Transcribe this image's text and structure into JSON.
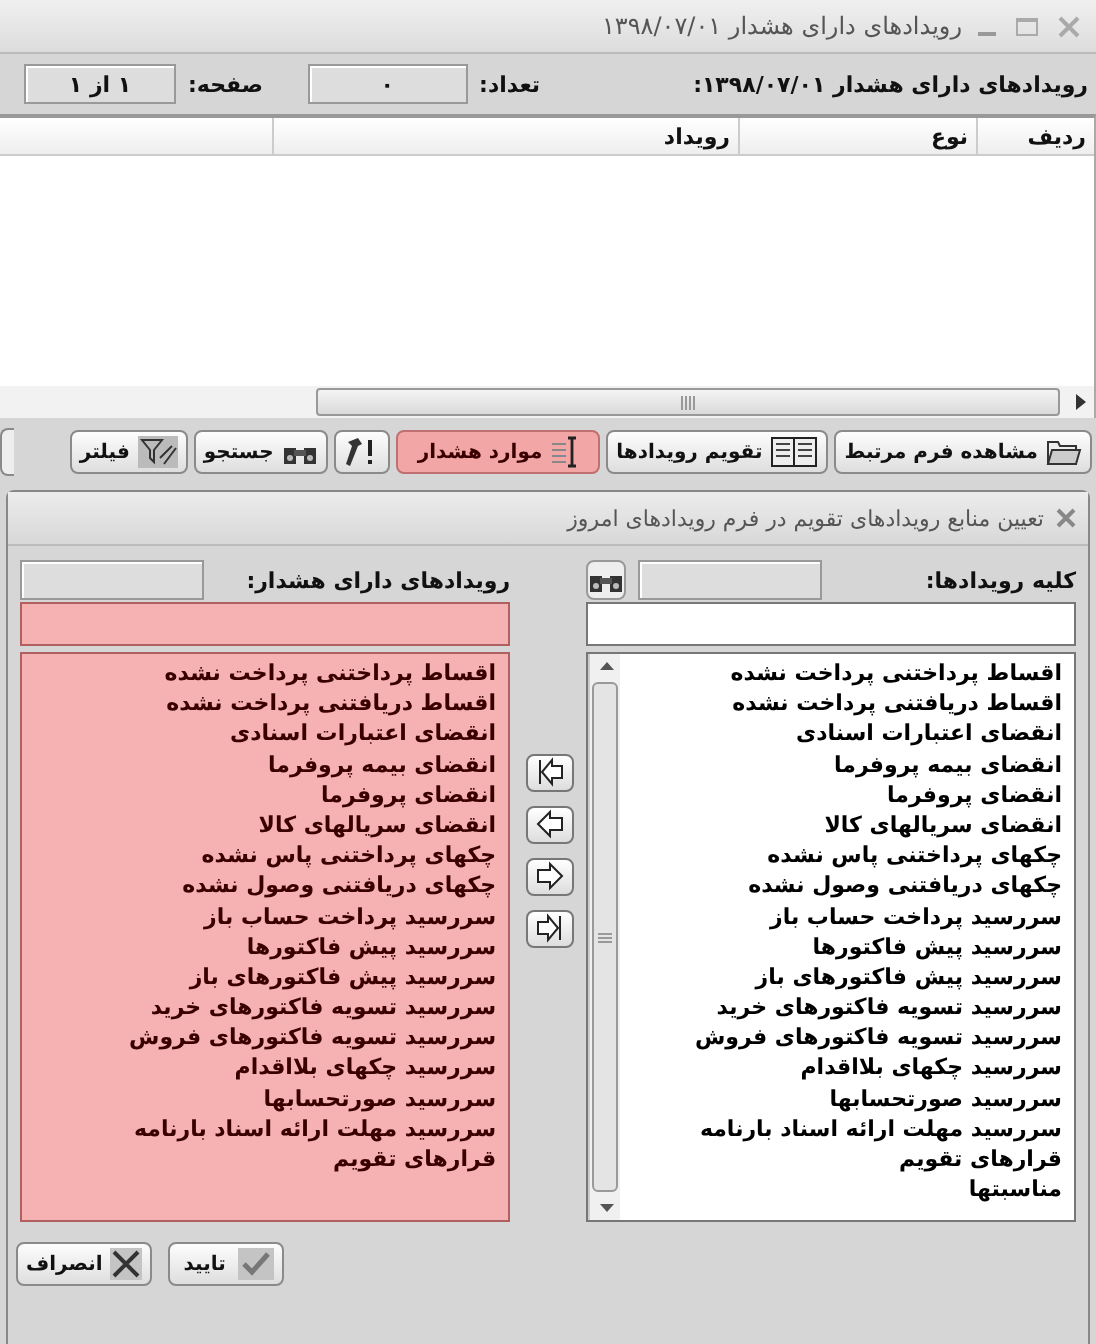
{
  "window": {
    "title": "رویدادهای دارای هشدار ۱۳۹۸/۰۷/۰۱"
  },
  "summary": {
    "label": "رویدادهای دارای هشدار ۱۳۹۸/۰۷/۰۱:",
    "count_label": "تعداد:",
    "count": "۰",
    "page_label": "صفحه:",
    "page": "۱ از ۱"
  },
  "table": {
    "columns": [
      "ردیف",
      "نوع",
      "رویداد"
    ]
  },
  "toolbar": [
    {
      "label": "مشاهده فرم مرتبط",
      "kind": "folder",
      "highlighted": false
    },
    {
      "label": "تقویم رویدادها",
      "kind": "book",
      "highlighted": false
    },
    {
      "label": "موارد هشدار",
      "kind": "list",
      "highlighted": true
    },
    {
      "kind": "tools",
      "highlighted": false
    },
    {
      "label": "جستجو",
      "kind": "binoculars",
      "highlighted": false
    },
    {
      "label": "فیلتر",
      "kind": "funnel",
      "highlighted": false
    }
  ],
  "dialog": {
    "title": "تعیین منابع رویدادهای تقویم در فرم رویدادهای امروز",
    "source": {
      "label": "کلیه رویدادها:",
      "highlighted": false,
      "items": [
        "اقساط پرداختنی پرداخت نشده",
        "اقساط دریافتنی پرداخت نشده",
        "انقضای اعتبارات اسنادی",
        "انقضای بیمه پروفرما",
        "انقضای پروفرما",
        "انقضای سریالهای کالا",
        "چکهای پرداختنی پاس نشده",
        "چکهای دریافتنی وصول نشده",
        "سررسید پرداخت حساب باز",
        "سررسید پیش فاکتورها",
        "سررسید پیش فاکتورهای باز",
        "سررسید تسویه فاکتورهای خرید",
        "سررسید تسویه فاکتورهای فروش",
        "سررسید چکهای بلااقدام",
        "سررسید صورتحسابها",
        "سررسید مهلت ارائه اسناد بارنامه",
        "قرارهای تقویم",
        "مناسبتها"
      ]
    },
    "target": {
      "label": "رویدادهای دارای هشدار:",
      "highlighted": true,
      "items": [
        "اقساط پرداختنی پرداخت نشده",
        "اقساط دریافتنی پرداخت نشده",
        "انقضای اعتبارات اسنادی",
        "انقضای بیمه پروفرما",
        "انقضای پروفرما",
        "انقضای سریالهای کالا",
        "چکهای پرداختنی پاس نشده",
        "چکهای دریافتنی وصول نشده",
        "سررسید پرداخت حساب باز",
        "سررسید پیش فاکتورها",
        "سررسید پیش فاکتورهای باز",
        "سررسید تسویه فاکتورهای خرید",
        "سررسید تسویه فاکتورهای فروش",
        "سررسید چکهای بلااقدام",
        "سررسید صورتحسابها",
        "سررسید مهلت ارائه اسناد بارنامه",
        "قرارهای تقویم"
      ]
    },
    "buttons": [
      {
        "label": "تایید",
        "kind": "check"
      },
      {
        "label": "انصراف",
        "kind": "cross"
      }
    ]
  }
}
